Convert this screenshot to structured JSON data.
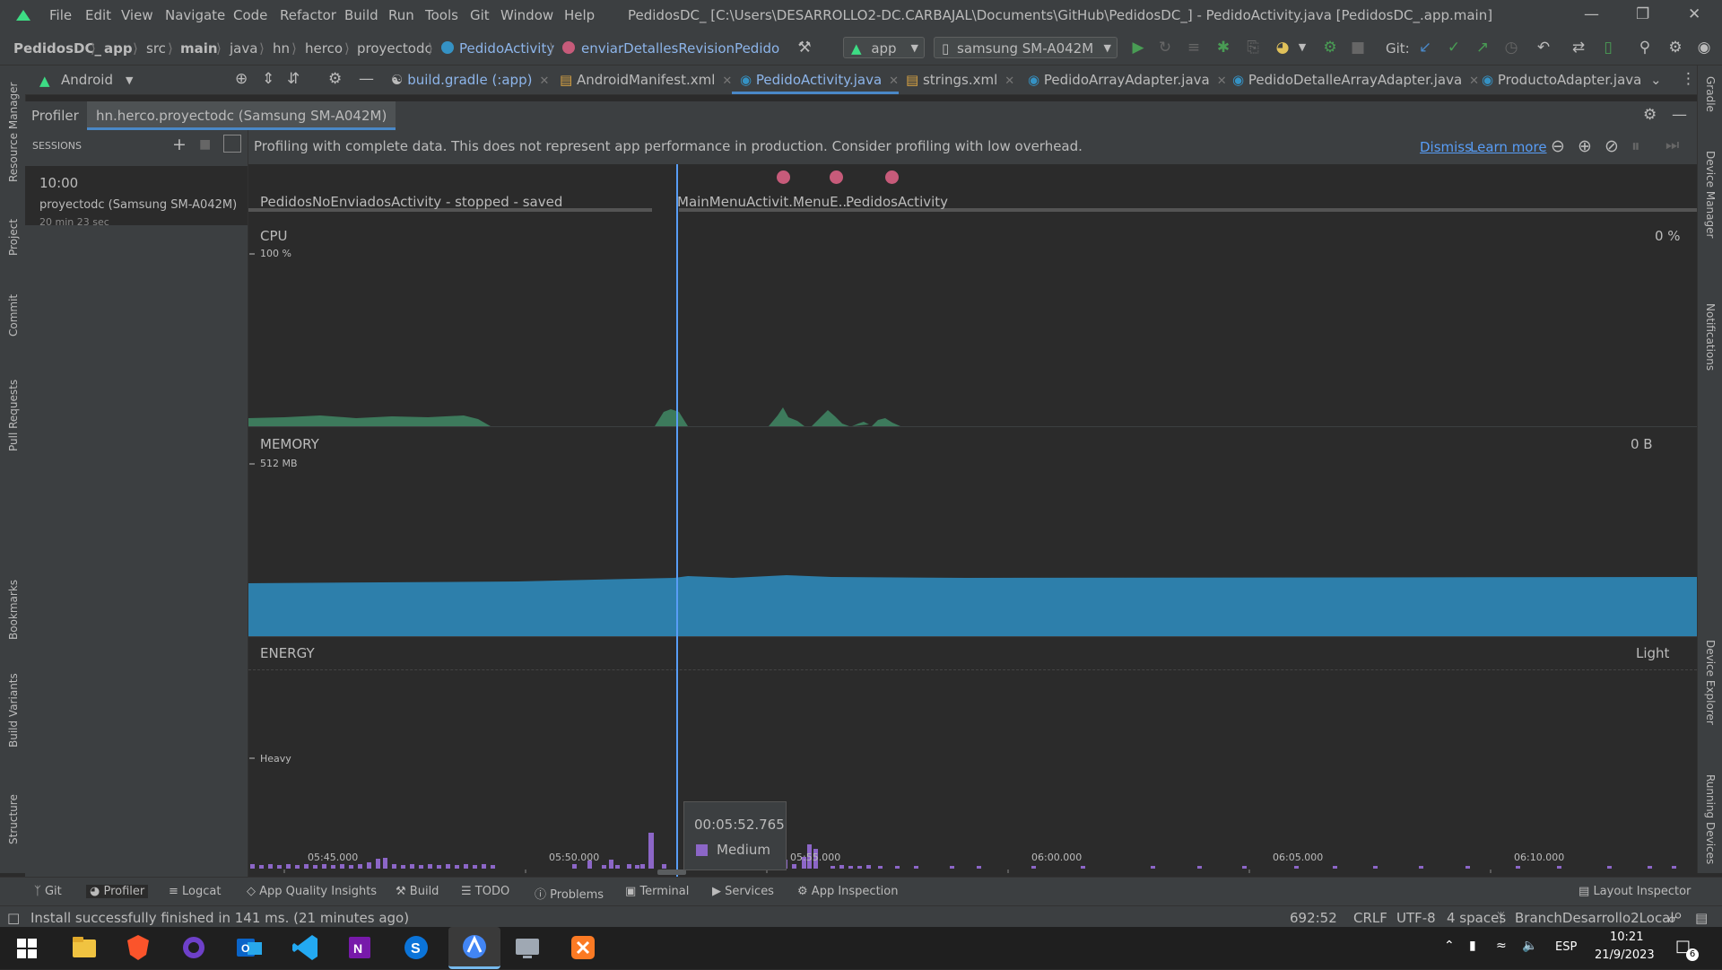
{
  "menubar": {
    "items": [
      "File",
      "Edit",
      "View",
      "Navigate",
      "Code",
      "Refactor",
      "Build",
      "Run",
      "Tools",
      "Git",
      "Window",
      "Help"
    ],
    "title": "PedidosDC_ [C:\\Users\\DESARROLLO2-DC.CARBAJAL\\Documents\\GitHub\\PedidosDC_] - PedidoActivity.java [PedidosDC_.app.main]"
  },
  "breadcrumb": [
    "PedidosDC_",
    "app",
    "src",
    "main",
    "java",
    "hn",
    "herco",
    "proyectodc",
    "PedidoActivity",
    "enviarDetallesRevisionPedido"
  ],
  "toolbar": {
    "run_config": "app",
    "device": "samsung SM-A042M",
    "git_label": "Git:"
  },
  "project_view": {
    "mode": "Android"
  },
  "file_tabs": [
    {
      "label": "build.gradle (:app)",
      "active": false
    },
    {
      "label": "AndroidManifest.xml",
      "active": false
    },
    {
      "label": "PedidoActivity.java",
      "active": true
    },
    {
      "label": "strings.xml",
      "active": false
    },
    {
      "label": "PedidoArrayAdapter.java",
      "active": false
    },
    {
      "label": "PedidoDetalleArrayAdapter.java",
      "active": false
    },
    {
      "label": "ProductoAdapter.java",
      "active": false
    }
  ],
  "left_tools": [
    "Resource Manager",
    "Project",
    "Commit",
    "Pull Requests",
    "Bookmarks",
    "Build Variants",
    "Structure"
  ],
  "right_tools": [
    "Gradle",
    "Device Manager",
    "Notifications",
    "Device Explorer",
    "Running Devices"
  ],
  "profiler": {
    "tab_label": "Profiler",
    "session_tab": "hn.herco.proyectodc (Samsung SM-A042M)",
    "sessions_header": "SESSIONS",
    "session": {
      "time": "10:00",
      "name": "proyectodc (Samsung SM-A042M)",
      "duration": "20 min 23 sec"
    },
    "banner": {
      "text": "Profiling with complete data. This does not represent app performance in production. Consider profiling with low overhead.",
      "dismiss": "Dismiss",
      "learn_more": "Learn more"
    },
    "activities": [
      "PedidosNoEnviadosActivity - stopped - saved",
      "MainMenuActivit...",
      "MenuE...",
      "PedidosActivity"
    ],
    "cpu": {
      "title": "CPU",
      "value": "0 %",
      "scale": "100 %"
    },
    "memory": {
      "title": "MEMORY",
      "value": "0 B",
      "scale": "512 MB"
    },
    "energy": {
      "title": "ENERGY",
      "value": "Light",
      "scale": "Heavy"
    },
    "time_axis": [
      "05:45.000",
      "05:50.000",
      "05:55.000",
      "06:00.000",
      "06:05.000",
      "06:10.000"
    ],
    "tooltip": {
      "time": "00:05:52.765",
      "level": "Medium"
    }
  },
  "bottom_tools": [
    "Git",
    "Profiler",
    "Logcat",
    "App Quality Insights",
    "Build",
    "TODO",
    "Problems",
    "Terminal",
    "Services",
    "App Inspection"
  ],
  "layout_inspector": "Layout Inspector",
  "status": {
    "message": "Install successfully finished in 141 ms. (21 minutes ago)",
    "position": "692:52",
    "line_sep": "CRLF",
    "encoding": "UTF-8",
    "indent": "4 spaces",
    "branch": "BranchDesarrollo2Local"
  },
  "taskbar": {
    "lang": "ESP",
    "time": "10:21",
    "date": "21/9/2023",
    "notif_count": "6"
  },
  "colors": {
    "cpu": "#3d7a5c",
    "memory": "#2d7fab",
    "energy": "#8c66c7",
    "accent": "#4a88c7",
    "activity_dot": "#c75b7a"
  }
}
